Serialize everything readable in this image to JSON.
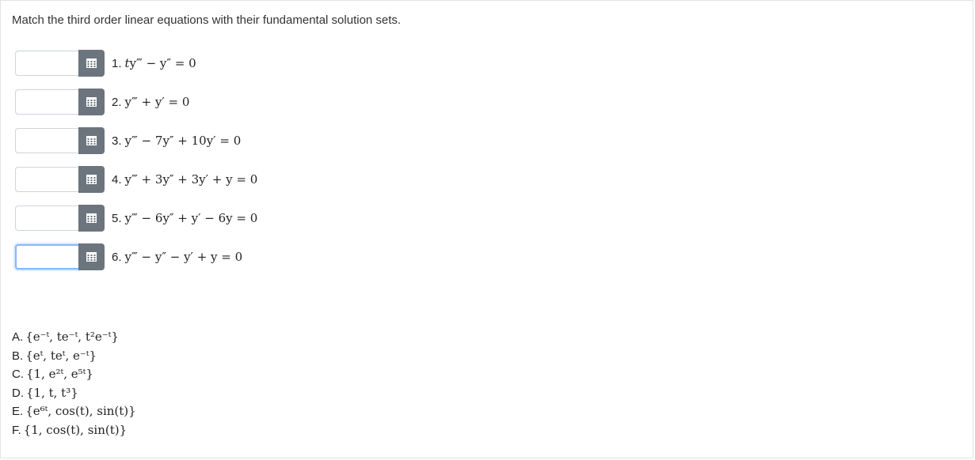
{
  "prompt": "Match the third order linear equations with their fundamental solution sets.",
  "picker_icon": "grid-picker-icon",
  "colors": {
    "picker_button": "#6c757d",
    "focus_border": "#86b7fe"
  },
  "questions": [
    {
      "num": "1.",
      "value": "",
      "parts": [
        "t",
        "y‴ − y″ = 0"
      ]
    },
    {
      "num": "2.",
      "value": "",
      "parts": [
        "y‴ + y′ = 0"
      ]
    },
    {
      "num": "3.",
      "value": "",
      "parts": [
        "y‴ − 7y″ + 10y′ = 0"
      ]
    },
    {
      "num": "4.",
      "value": "",
      "parts": [
        "y‴ + 3y″ + 3y′ + y = 0"
      ]
    },
    {
      "num": "5.",
      "value": "",
      "parts": [
        "y‴ − 6y″ + y′ − 6y = 0"
      ]
    },
    {
      "num": "6.",
      "value": "",
      "parts": [
        "y‴ − y″ − y′ + y = 0"
      ]
    }
  ],
  "choices": [
    {
      "label": "A.",
      "text": "{e⁻ᵗ, te⁻ᵗ, t²e⁻ᵗ}"
    },
    {
      "label": "B.",
      "text": "{eᵗ, teᵗ, e⁻ᵗ}"
    },
    {
      "label": "C.",
      "text": "{1, e²ᵗ, e⁵ᵗ}"
    },
    {
      "label": "D.",
      "text": "{1, t, t³}"
    },
    {
      "label": "E.",
      "text": "{e⁶ᵗ, cos(t), sin(t)}"
    },
    {
      "label": "F.",
      "text": "{1, cos(t), sin(t)}"
    }
  ]
}
